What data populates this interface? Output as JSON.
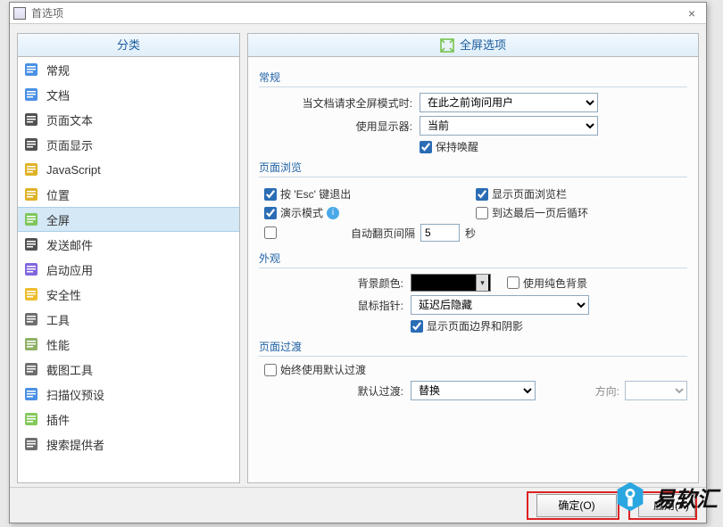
{
  "window": {
    "title": "首选项"
  },
  "sidebar": {
    "header": "分类",
    "items": [
      {
        "label": "常规",
        "icon": "#2a7de1"
      },
      {
        "label": "文档",
        "icon": "#2a7de1"
      },
      {
        "label": "页面文本",
        "icon": "#333"
      },
      {
        "label": "页面显示",
        "icon": "#333"
      },
      {
        "label": "JavaScript",
        "icon": "#d9a400"
      },
      {
        "label": "位置",
        "icon": "#d9a400"
      },
      {
        "label": "全屏",
        "icon": "#6fbf3f"
      },
      {
        "label": "发送邮件",
        "icon": "#333"
      },
      {
        "label": "启动应用",
        "icon": "#6b4bd8"
      },
      {
        "label": "安全性",
        "icon": "#eab308"
      },
      {
        "label": "工具",
        "icon": "#555"
      },
      {
        "label": "性能",
        "icon": "#7aa34a"
      },
      {
        "label": "截图工具",
        "icon": "#555"
      },
      {
        "label": "扫描仪预设",
        "icon": "#2a7de1"
      },
      {
        "label": "插件",
        "icon": "#6fbf3f"
      },
      {
        "label": "搜索提供者",
        "icon": "#555"
      }
    ],
    "selected_index": 6
  },
  "right": {
    "header": "全屏选项",
    "general": {
      "title": "常规",
      "fullscreen_request_label": "当文档请求全屏模式时:",
      "fullscreen_request_value": "在此之前询问用户",
      "display_label": "使用显示器:",
      "display_value": "当前",
      "keep_awake_checked": true,
      "keep_awake_label": "保持唤醒"
    },
    "nav": {
      "title": "页面浏览",
      "esc_exit": {
        "checked": true,
        "label": "按 'Esc' 键退出"
      },
      "presentation": {
        "checked": true,
        "label": "演示模式"
      },
      "show_navbar": {
        "checked": true,
        "label": "显示页面浏览栏"
      },
      "loop_last": {
        "checked": false,
        "label": "到达最后一页后循环"
      },
      "auto_turn": {
        "checked": false,
        "label": "自动翻页间隔",
        "value": "5",
        "unit": "秒"
      }
    },
    "appearance": {
      "title": "外观",
      "bg_color_label": "背景颜色:",
      "bg_color_value": "#000000",
      "solid_bg": {
        "checked": false,
        "label": "使用纯色背景"
      },
      "pointer_label": "鼠标指针:",
      "pointer_value": "延迟后隐藏",
      "show_shadow": {
        "checked": true,
        "label": "显示页面边界和阴影"
      }
    },
    "transition": {
      "title": "页面过渡",
      "always_default": {
        "checked": false,
        "label": "始终使用默认过渡"
      },
      "default_label": "默认过渡:",
      "default_value": "替换",
      "direction_label": "方向:"
    }
  },
  "footer": {
    "ok": "确定(O)",
    "apply": "应用(A)"
  },
  "watermark": "易软汇"
}
